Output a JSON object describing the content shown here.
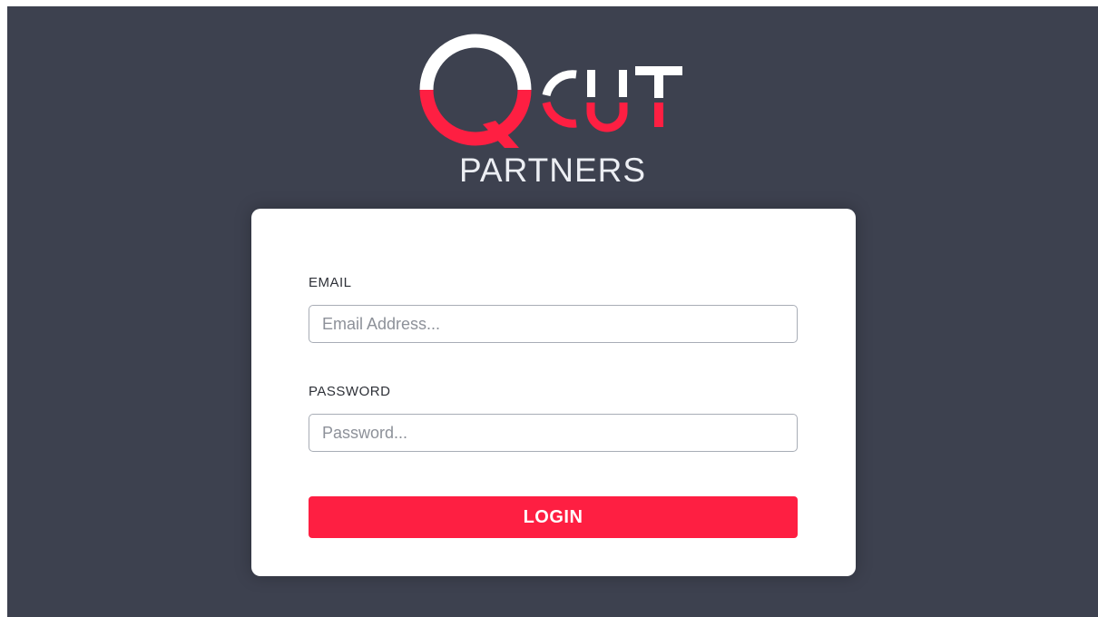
{
  "brand": {
    "logo_text": "QCUT",
    "subtitle": "PARTNERS",
    "accent_color": "#fe1f42",
    "background_color": "#3d414f"
  },
  "login_form": {
    "email_label": "EMAIL",
    "email_placeholder": "Email Address...",
    "email_value": "",
    "password_label": "PASSWORD",
    "password_placeholder": "Password...",
    "password_value": "",
    "login_label": "LOGIN"
  }
}
